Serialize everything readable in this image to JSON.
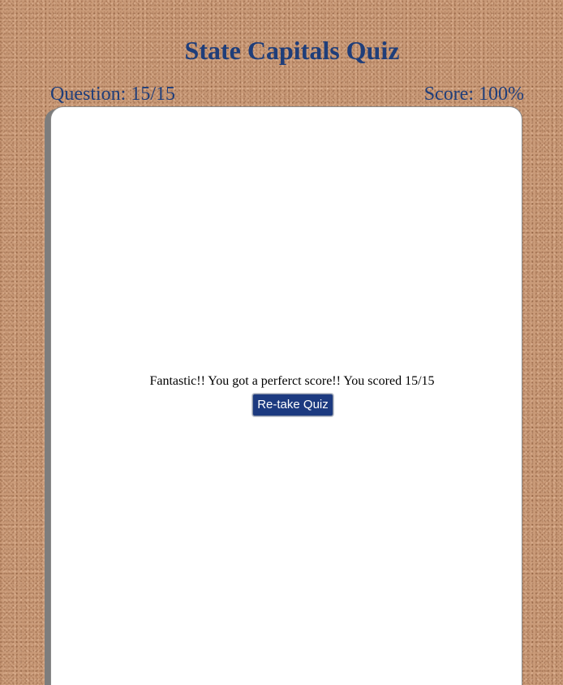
{
  "page": {
    "title": "State Capitals Quiz"
  },
  "status": {
    "question_label": "Question: 15/15",
    "score_label": "Score: 100%"
  },
  "result": {
    "message": "Fantastic!! You got a perferct score!! You scored 15/15",
    "retake_label": "Re-take Quiz"
  },
  "colors": {
    "heading": "#1f3e7a",
    "button_bg": "#1c3a80",
    "button_text": "#ffffff",
    "card_bg": "#ffffff",
    "background": "#c99a78"
  }
}
